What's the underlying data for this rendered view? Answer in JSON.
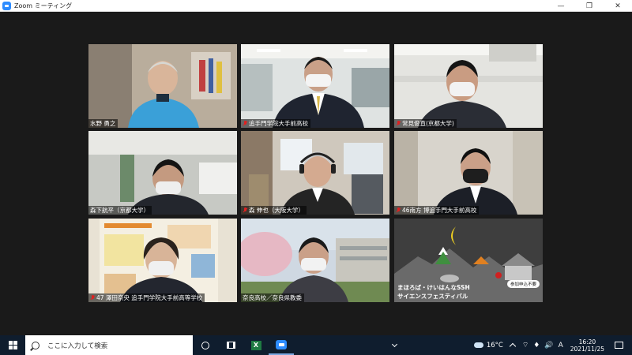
{
  "window": {
    "title": "Zoom ミーティング",
    "minimize_glyph": "—",
    "maximize_glyph": "❐",
    "close_glyph": "✕"
  },
  "participants": [
    {
      "name": "水野 勇之",
      "muted": false
    },
    {
      "name": "追手門学院大手前高校",
      "muted": true
    },
    {
      "name": "常見俊直(京都大学)",
      "muted": true
    },
    {
      "name": "森下航平（京都大学）",
      "muted": false
    },
    {
      "name": "森 伸也（大阪大学）",
      "muted": true
    },
    {
      "name": "46南方 博追手門大手前高校",
      "muted": true
    },
    {
      "name": "47 澤田奈央 追手門学院大手前高等学校",
      "muted": true
    },
    {
      "name": "奈良高校／奈良県教委",
      "muted": false
    },
    {
      "name": "",
      "muted": false
    }
  ],
  "poster": {
    "line1": "まほろば・けいはんなSSH",
    "line2": "サイエンスフェスティバル",
    "badge": "参加申込不要"
  },
  "taskbar": {
    "search_placeholder": "ここに入力して検索",
    "weather": "16°C",
    "time": "16:20",
    "date": "2021/11/25",
    "excel_letter": "X",
    "speaker_glyph": "🔊",
    "ime_glyph": "A",
    "network_glyph": "⌔",
    "mic_glyph": "♦"
  }
}
